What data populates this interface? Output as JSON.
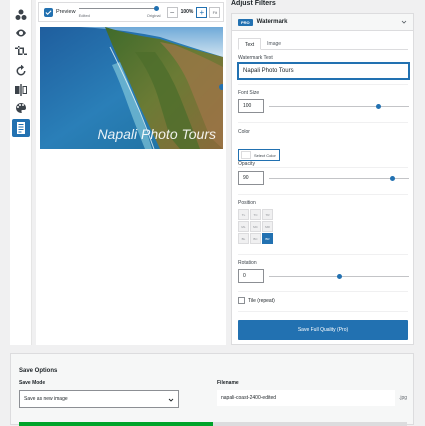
{
  "toolbar": {
    "tools": [
      {
        "icon": "shapes-icon"
      },
      {
        "icon": "eye-icon"
      },
      {
        "icon": "crop-icon"
      },
      {
        "icon": "rotate-icon"
      },
      {
        "icon": "flip-icon"
      },
      {
        "icon": "palette-icon"
      },
      {
        "icon": "document-icon",
        "active": true
      }
    ]
  },
  "preview": {
    "label": "Preview",
    "checked": true,
    "edited_label": "Edited",
    "original_label": "Original",
    "compare_fraction": 0.98,
    "zoom_minus": "−",
    "zoom_value": "100%",
    "zoom_plus": "+",
    "fit_label": "Fit",
    "watermark_text": "Napali Photo Tours"
  },
  "filters": {
    "title": "Adjust Filters",
    "panel": {
      "badge": "PRO",
      "title": "Watermark",
      "tabs": [
        "Text",
        "Image"
      ],
      "active_tab": 0,
      "watermark_text_label": "Watermark Text",
      "watermark_text_value": "Napali Photo Tours",
      "font_size_label": "Font Size",
      "font_size_value": "100",
      "font_size_fraction": 0.78,
      "color_label": "Color",
      "select_color_label": "Select Color",
      "opacity_label": "Opacity",
      "opacity_value": "90",
      "opacity_fraction": 0.88,
      "position_label": "Position",
      "position_cells": [
        "TL",
        "TC",
        "TR",
        "ML",
        "MC",
        "MR",
        "BL",
        "BC",
        "BR"
      ],
      "position_active": 8,
      "rotation_label": "Rotation",
      "rotation_value": "0",
      "rotation_fraction": 0.5,
      "tile_label": "Tile (repeat)",
      "tile_checked": false,
      "save_button": "Save Full Quality (Pro)"
    }
  },
  "save_options": {
    "title": "Save Options",
    "mode_label": "Save Mode",
    "mode_value": "Save as new image",
    "filename_label": "Filename",
    "filename_value": "napali-coast-2400-edited",
    "extension": ".jpg",
    "progress_fraction": 0.5
  },
  "colors": {
    "accent": "#2271b1",
    "progress": "#00a32a"
  }
}
